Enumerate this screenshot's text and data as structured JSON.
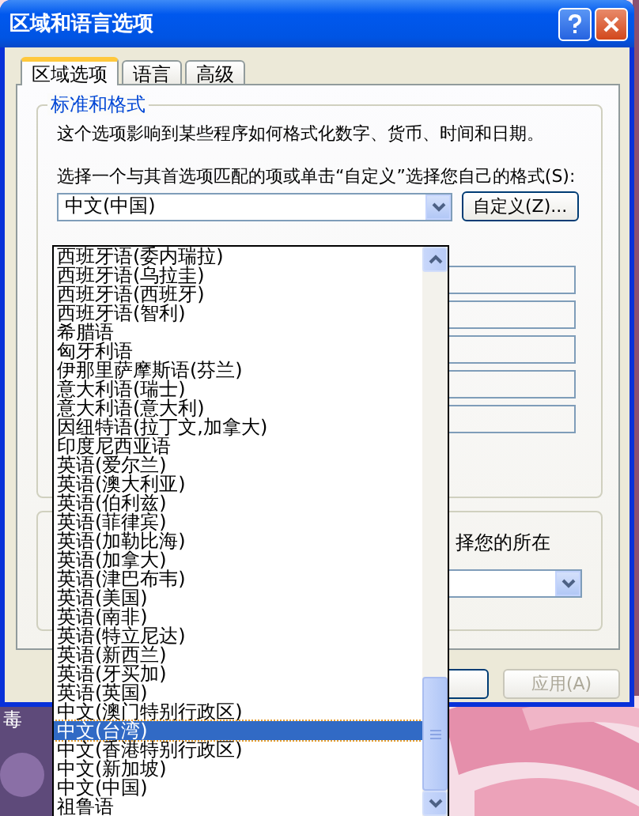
{
  "window": {
    "title": "区域和语言选项"
  },
  "tabs": [
    {
      "label": "区域选项",
      "selected": true
    },
    {
      "label": "语言",
      "selected": false
    },
    {
      "label": "高级",
      "selected": false
    }
  ],
  "standards_group": {
    "title": "标准和格式",
    "description": "这个选项影响到某些程序如何格式化数字、货币、时间和日期。",
    "prompt": "选择一个与其首选项匹配的项或单击“自定义”选择您自己的格式(S):",
    "format_combo": {
      "value": "中文(中国)"
    },
    "customize_button": "自定义(Z)..."
  },
  "location_group": {
    "prompt_fragment": "择您的所在"
  },
  "buttons": [
    {
      "label": "应用(A)",
      "disabled": true
    }
  ],
  "dropdown": {
    "items": [
      {
        "label": "西班牙语(委内瑞拉)",
        "selected": false
      },
      {
        "label": "西班牙语(乌拉圭)",
        "selected": false
      },
      {
        "label": "西班牙语(西班牙)",
        "selected": false
      },
      {
        "label": "西班牙语(智利)",
        "selected": false
      },
      {
        "label": "希腊语",
        "selected": false
      },
      {
        "label": "匈牙利语",
        "selected": false
      },
      {
        "label": "伊那里萨摩斯语(芬兰)",
        "selected": false
      },
      {
        "label": "意大利语(瑞士)",
        "selected": false
      },
      {
        "label": "意大利语(意大利)",
        "selected": false
      },
      {
        "label": "因纽特语(拉丁文,加拿大)",
        "selected": false
      },
      {
        "label": "印度尼西亚语",
        "selected": false
      },
      {
        "label": "英语(爱尔兰)",
        "selected": false
      },
      {
        "label": "英语(澳大利亚)",
        "selected": false
      },
      {
        "label": "英语(伯利兹)",
        "selected": false
      },
      {
        "label": "英语(菲律宾)",
        "selected": false
      },
      {
        "label": "英语(加勒比海)",
        "selected": false
      },
      {
        "label": "英语(加拿大)",
        "selected": false
      },
      {
        "label": "英语(津巴布韦)",
        "selected": false
      },
      {
        "label": "英语(美国)",
        "selected": false
      },
      {
        "label": "英语(南非)",
        "selected": false
      },
      {
        "label": "英语(特立尼达)",
        "selected": false
      },
      {
        "label": "英语(新西兰)",
        "selected": false
      },
      {
        "label": "英语(牙买加)",
        "selected": false
      },
      {
        "label": "英语(英国)",
        "selected": false
      },
      {
        "label": "中文(澳门特别行政区)",
        "selected": false
      },
      {
        "label": "中文(台湾)",
        "selected": true
      },
      {
        "label": "中文(香港特别行政区)",
        "selected": false
      },
      {
        "label": "中文(新加坡)",
        "selected": false
      },
      {
        "label": "中文(中国)",
        "selected": false
      },
      {
        "label": "祖鲁语",
        "selected": false
      }
    ]
  },
  "desktop_icon_label": "毒"
}
